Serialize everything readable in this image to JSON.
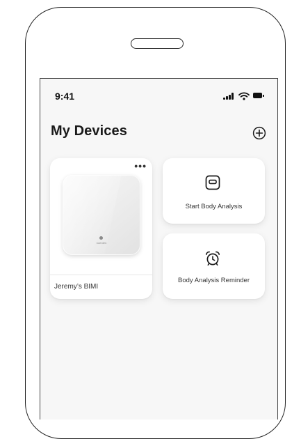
{
  "status_bar": {
    "time": "9:41",
    "signal_icon": "cellular-signal",
    "wifi_icon": "wifi",
    "battery_icon": "battery"
  },
  "header": {
    "title": "My Devices",
    "add_icon": "plus-circle"
  },
  "devices": [
    {
      "name": "Jeremy’s BIMI",
      "brand_mark": "noerden",
      "more_icon": "ellipsis"
    }
  ],
  "actions": [
    {
      "label": "Start Body Analysis",
      "icon": "scale"
    },
    {
      "label": "Body Analysis Reminder",
      "icon": "alarm-clock"
    }
  ],
  "colors": {
    "screen_background": "#f7f7f7",
    "card_background": "#ffffff",
    "text_primary": "#1a1a1a",
    "device_frame": "#222222"
  }
}
